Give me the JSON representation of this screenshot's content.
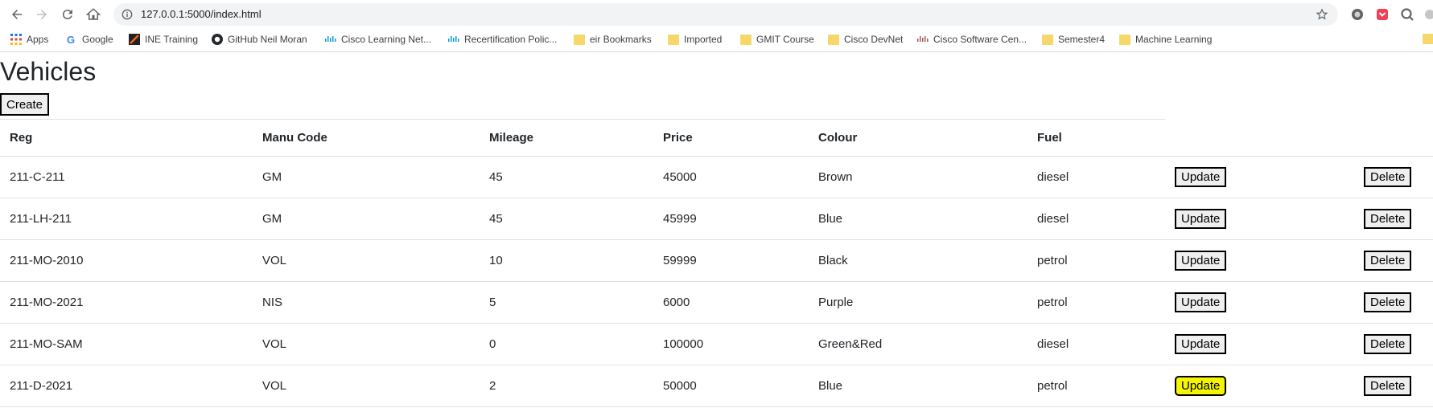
{
  "browser": {
    "url": "127.0.0.1:5000/index.html",
    "bookmarks": [
      {
        "label": "Apps",
        "icon": "apps-grid-icon"
      },
      {
        "label": "Google",
        "icon": "google-icon"
      },
      {
        "label": "INE Training",
        "icon": "ine-icon"
      },
      {
        "label": "GitHub Neil Moran",
        "icon": "github-icon"
      },
      {
        "label": "Cisco Learning Net...",
        "icon": "cisco-icon"
      },
      {
        "label": "Recertification Polic...",
        "icon": "cisco-icon"
      },
      {
        "label": "eir Bookmarks",
        "icon": "folder-icon"
      },
      {
        "label": "Imported",
        "icon": "folder-icon"
      },
      {
        "label": "GMIT Course",
        "icon": "folder-icon"
      },
      {
        "label": "Cisco DevNet",
        "icon": "folder-icon"
      },
      {
        "label": "Cisco Software Cen...",
        "icon": "cisco-icon"
      },
      {
        "label": "Semester4",
        "icon": "folder-icon"
      },
      {
        "label": "Machine Learning",
        "icon": "folder-icon"
      }
    ]
  },
  "page": {
    "title": "Vehicles",
    "create_label": "Create"
  },
  "table": {
    "headers": {
      "reg": "Reg",
      "manu": "Manu Code",
      "mileage": "Mileage",
      "price": "Price",
      "colour": "Colour",
      "fuel": "Fuel"
    },
    "update_label": "Update",
    "delete_label": "Delete",
    "rows": [
      {
        "reg": "211-C-211",
        "manu": "GM",
        "mileage": "45",
        "price": "45000",
        "colour": "Brown",
        "fuel": "diesel"
      },
      {
        "reg": "211-LH-211",
        "manu": "GM",
        "mileage": "45",
        "price": "45999",
        "colour": "Blue",
        "fuel": "diesel"
      },
      {
        "reg": "211-MO-2010",
        "manu": "VOL",
        "mileage": "10",
        "price": "59999",
        "colour": "Black",
        "fuel": "petrol"
      },
      {
        "reg": "211-MO-2021",
        "manu": "NIS",
        "mileage": "5",
        "price": "6000",
        "colour": "Purple",
        "fuel": "petrol"
      },
      {
        "reg": "211-MO-SAM",
        "manu": "VOL",
        "mileage": "0",
        "price": "100000",
        "colour": "Green&Red",
        "fuel": "diesel"
      },
      {
        "reg": "211-D-2021",
        "manu": "VOL",
        "mileage": "2",
        "price": "50000",
        "colour": "Blue",
        "fuel": "petrol"
      }
    ],
    "highlight_color": "#f5f500"
  }
}
